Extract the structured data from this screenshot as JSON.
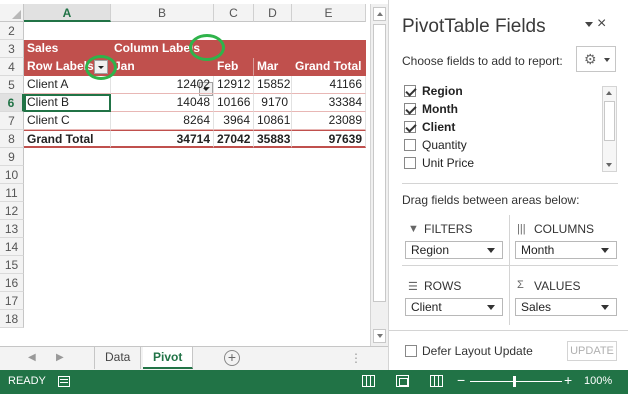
{
  "sheet": {
    "columns": [
      "A",
      "B",
      "C",
      "D",
      "E"
    ],
    "row_numbers": [
      "2",
      "3",
      "4",
      "5",
      "6",
      "7",
      "8",
      "9",
      "10",
      "11",
      "12",
      "13",
      "14",
      "15",
      "16",
      "17",
      "18"
    ],
    "pivot": {
      "values_label": "Sales",
      "column_labels": "Column Labels",
      "row_labels": "Row Labels",
      "col_headers": [
        "Jan",
        "Feb",
        "Mar",
        "Grand Total"
      ],
      "rows": [
        {
          "label": "Client A",
          "values": [
            "12402",
            "12912",
            "15852",
            "41166"
          ]
        },
        {
          "label": "Client B",
          "values": [
            "14048",
            "10166",
            "9170",
            "33384"
          ]
        },
        {
          "label": "Client C",
          "values": [
            "8264",
            "3964",
            "10861",
            "23089"
          ]
        }
      ],
      "grand_total": {
        "label": "Grand Total",
        "values": [
          "34714",
          "27042",
          "35883",
          "97639"
        ]
      }
    }
  },
  "tabs": {
    "items": [
      "Data",
      "Pivot"
    ],
    "active": "Pivot",
    "add_label": "+",
    "menu_label": "⋮"
  },
  "panel": {
    "title": "PivotTable Fields",
    "close_label": "×",
    "choose_label": "Choose fields to add to report:",
    "fields": [
      {
        "label": "Region",
        "checked": true
      },
      {
        "label": "Month",
        "checked": true
      },
      {
        "label": "Client",
        "checked": true
      },
      {
        "label": "Quantity",
        "checked": false
      },
      {
        "label": "Unit Price",
        "checked": false
      }
    ],
    "drag_label": "Drag fields between areas below:",
    "areas": {
      "filters": {
        "title": "FILTERS",
        "icon": "filter-icon",
        "value": "Region"
      },
      "columns": {
        "title": "COLUMNS",
        "icon": "columns-icon",
        "value": "Month"
      },
      "rows": {
        "title": "ROWS",
        "icon": "rows-icon",
        "value": "Client"
      },
      "values": {
        "title": "VALUES",
        "icon": "sigma-icon",
        "value": "Sales"
      }
    },
    "defer_label": "Defer Layout Update",
    "update_label": "UPDATE"
  },
  "status": {
    "ready": "READY",
    "zoom": "100%",
    "zoom_out": "−",
    "zoom_in": "+"
  },
  "colors": {
    "excel_green": "#217346",
    "pivot_header": "#c0504d",
    "highlight_circle": "#2fb34a"
  }
}
